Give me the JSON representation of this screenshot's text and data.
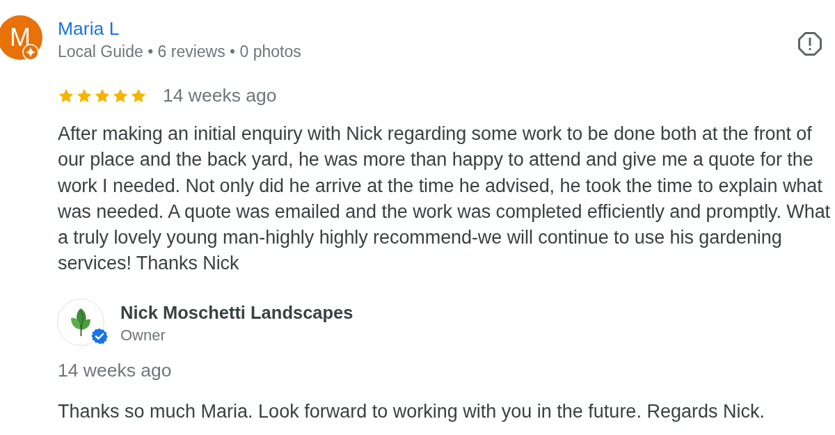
{
  "review": {
    "author": {
      "initial": "M",
      "name": "Maria L",
      "meta": "Local Guide • 6 reviews • 0 photos"
    },
    "stars": 5,
    "date": "14 weeks ago",
    "text": "After making an initial enquiry with Nick regarding some work to be done both at the front of our place and the back yard, he was more than happy to attend and give me a quote for the work I needed. Not only did he arrive at the time he advised, he took the time to explain what was needed. A quote was emailed and the work was completed efficiently and promptly. What a truly lovely young man-highly highly recommend-we will continue to use his gardening services! Thanks Nick"
  },
  "owner_response": {
    "name": "Nick Moschetti Landscapes",
    "role": "Owner",
    "date": "14 weeks ago",
    "text": "Thanks so much Maria. Look forward to working with you in the future. Regards Nick."
  }
}
